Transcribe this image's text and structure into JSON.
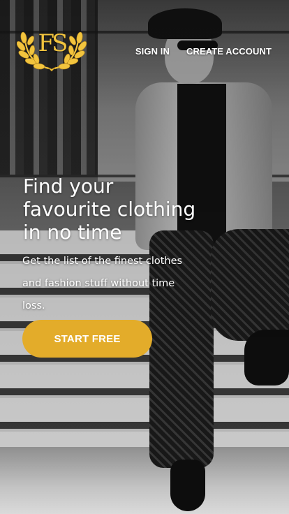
{
  "brand": {
    "logo_text": "FS",
    "logo_color": "#f2c43e",
    "logo_icon": "laurel-wreath-icon"
  },
  "nav": {
    "sign_in": "SIGN IN",
    "create_account": "CREATE ACCOUNT"
  },
  "hero": {
    "title": "Find your favourite clothing in no time",
    "subtitle": "Get the list of the finest clothes and fashion stuff without time loss.",
    "cta_label": "START FREE",
    "cta_color": "#e3ac2a"
  }
}
